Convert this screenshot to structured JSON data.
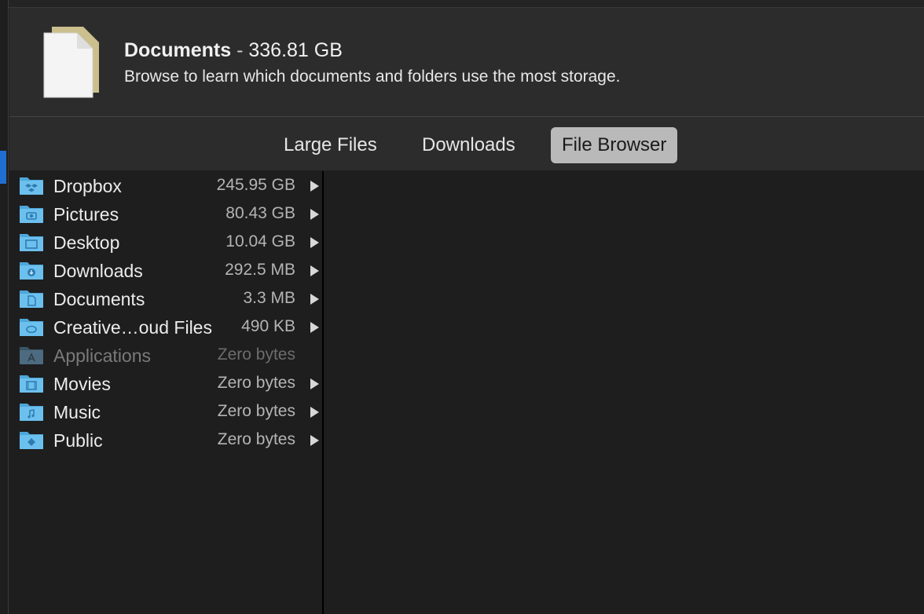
{
  "header": {
    "title": "Documents",
    "separator": "-",
    "total_size": "336.81 GB",
    "subtitle": "Browse to learn which documents and folders use the most storage."
  },
  "tabs": [
    {
      "label": "Large Files",
      "selected": false
    },
    {
      "label": "Downloads",
      "selected": false
    },
    {
      "label": "File Browser",
      "selected": true
    }
  ],
  "folders": [
    {
      "name": "Dropbox",
      "size": "245.95 GB",
      "icon": "dropbox-folder-icon",
      "expandable": true
    },
    {
      "name": "Pictures",
      "size": "80.43 GB",
      "icon": "pictures-folder-icon",
      "expandable": true
    },
    {
      "name": "Desktop",
      "size": "10.04 GB",
      "icon": "desktop-folder-icon",
      "expandable": true
    },
    {
      "name": "Downloads",
      "size": "292.5 MB",
      "icon": "downloads-folder-icon",
      "expandable": true
    },
    {
      "name": "Documents",
      "size": "3.3 MB",
      "icon": "documents-folder-icon",
      "expandable": true
    },
    {
      "name": "Creative…oud Files",
      "size": "490 KB",
      "icon": "creative-cloud-folder-icon",
      "expandable": true
    },
    {
      "name": "Applications",
      "size": "Zero bytes",
      "icon": "applications-folder-icon",
      "expandable": false
    },
    {
      "name": "Movies",
      "size": "Zero bytes",
      "icon": "movies-folder-icon",
      "expandable": true
    },
    {
      "name": "Music",
      "size": "Zero bytes",
      "icon": "music-folder-icon",
      "expandable": true
    },
    {
      "name": "Public",
      "size": "Zero bytes",
      "icon": "public-folder-icon",
      "expandable": true
    }
  ],
  "colors": {
    "background": "#1e1e1e",
    "header_bg": "#2c2c2c",
    "selected_tab": "#b9b9b9",
    "folder_blue": "#5eb0e0",
    "accent": "#1f6fd1"
  }
}
